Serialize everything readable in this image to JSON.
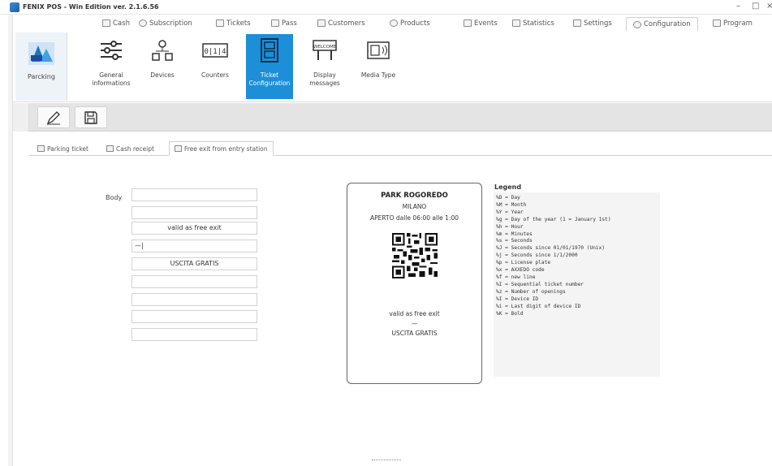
{
  "app": {
    "title": "FENIX POS - Win Edition ver. 2.1.6.56",
    "minimize": "–",
    "maximize": "□",
    "close": "×"
  },
  "top_tabs": [
    {
      "label": "Cash",
      "icon": "cash-register-icon"
    },
    {
      "label": "Subscription",
      "icon": "subscription-icon"
    },
    {
      "label": "Tickets",
      "icon": "tickets-icon"
    },
    {
      "label": "Pass",
      "icon": "pass-icon"
    },
    {
      "label": "Customers",
      "icon": "customers-icon"
    },
    {
      "label": "Products",
      "icon": "products-icon"
    },
    {
      "label": "Events",
      "icon": "events-icon"
    },
    {
      "label": "Statistics",
      "icon": "statistics-icon"
    },
    {
      "label": "Settings",
      "icon": "settings-icon"
    },
    {
      "label": "Configuration",
      "icon": "gear-icon",
      "active": true
    },
    {
      "label": "Program",
      "icon": "program-icon"
    }
  ],
  "ribbon": {
    "parking_label": "Parcking",
    "buttons": [
      {
        "label": "General informations",
        "icon": "sliders-icon"
      },
      {
        "label": "Devices",
        "icon": "devices-icon"
      },
      {
        "label": "Counters",
        "icon": "counter-icon"
      },
      {
        "label": "Ticket Configuration",
        "icon": "ticket-config-icon",
        "active": true
      },
      {
        "label": "Display messages",
        "icon": "welcome-display-icon"
      },
      {
        "label": "Media Type",
        "icon": "media-type-icon"
      }
    ]
  },
  "toolbar": {
    "edit": "pencil-icon",
    "save": "floppy-disk-icon"
  },
  "inner_tabs": [
    {
      "label": "Parking ticket",
      "icon": "ticket-icon"
    },
    {
      "label": "Cash receipt",
      "icon": "receipt-icon"
    },
    {
      "label": "Free exit from entry station",
      "icon": "ticket-exit-icon",
      "active": true
    }
  ],
  "form": {
    "body_label": "Body",
    "fields": [
      "",
      "",
      "valid as free exit",
      "—|",
      "USCITA GRATIS",
      "",
      "",
      "",
      ""
    ]
  },
  "preview": {
    "title": "PARK ROGOREDO",
    "city": "MILANO",
    "hours": "APERTO dalle 06:00 alle 1:00",
    "line1": "valid as free exit",
    "line2": "—",
    "line3": "USCITA GRATIS"
  },
  "legend": {
    "title": "Legend",
    "items": [
      "%D = Day",
      "%M = Month",
      "%Y = Year",
      "%g = Day of the year (1 = January 1st)",
      "%h = Hour",
      "%m = Minutes",
      "%s = Seconds",
      "%J = Seconds since 01/01/1970 (Unix)",
      "%j = Seconds since 1/1/2000",
      "%p = License plate",
      "%x = AXXEDO code",
      "%f = new line",
      "%I = Sequential ticket number",
      "%z = Number of openings",
      "%I = Device ID",
      "%i = Last digit of device ID",
      "%K = Bold"
    ]
  }
}
